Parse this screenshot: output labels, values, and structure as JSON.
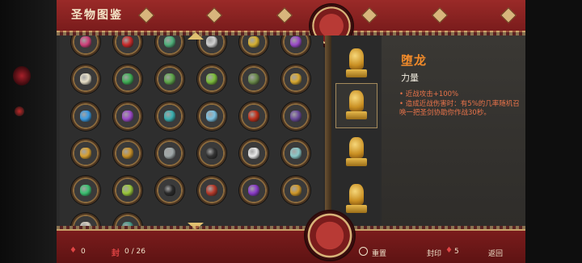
{
  "header": {
    "title": "圣物图鉴"
  },
  "grid": {
    "rows": [
      [
        "pink-flower",
        "red-sword",
        "green-arrow",
        "white-claw",
        "yellow-spider",
        "purple-crystal"
      ],
      [
        "yin-yang-charm",
        "green-orb",
        "green-bead-chain",
        "green-gourd",
        "green-book",
        "gold-scroll"
      ],
      [
        "blue-flower",
        "purple-flask",
        "teal-hook",
        "blue-crystal-shard",
        "red-ant",
        "purple-rod"
      ],
      [
        "gold-bell",
        "gold-lion-statue",
        "black-bead-string",
        "black-bow",
        "white-cloud",
        "teal-card"
      ],
      [
        "green-jade",
        "green-gem-cluster",
        "black-bomb",
        "red-spear",
        "purple-butterfly",
        "gold-dragon-statue"
      ],
      [
        "white-pearl",
        "teal-tree"
      ]
    ],
    "gem_colors": [
      "#d0407a",
      "#c82a2a",
      "#4fb07a",
      "#d0d0d0",
      "#d6b030",
      "#9a4ac8",
      "#e8e0c8",
      "#3fae55",
      "#5ea64a",
      "#7cbc3a",
      "#6a8a4a",
      "#d8a830",
      "#3a9ae0",
      "#9b4ac8",
      "#3ab0b0",
      "#7ac0e0",
      "#c0301a",
      "#6a4a9a",
      "#d8a030",
      "#c89028",
      "#a0a8a8",
      "#333333",
      "#e8e8e8",
      "#8ac8c8",
      "#3ac070",
      "#9ac83a",
      "#2a2a2a",
      "#b83a2a",
      "#8a3ac8",
      "#d09828",
      "#d8d0c0",
      "#4a9a8a"
    ]
  },
  "list": {
    "items": [
      "gold-dragon-seal",
      "gold-dragon-seal",
      "gold-dragon-seal",
      "gold-dragon-seal"
    ],
    "selected_index": 1
  },
  "detail": {
    "name": "堕龙",
    "category": "力量",
    "lines": [
      {
        "text": "• 近战攻击+100%",
        "color": "#e8734a"
      },
      {
        "text": "• 造成近战伤害时：有5%的几率随机召唤一把圣剑协助你作战30秒。",
        "color": "#e8734a"
      }
    ]
  },
  "footer": {
    "currency_count": "0",
    "seal_icon": "封",
    "seal_progress": "0 / 26",
    "reset_label": "重置",
    "seal_label": "封印",
    "seal_count": "5",
    "back_label": "返回"
  }
}
